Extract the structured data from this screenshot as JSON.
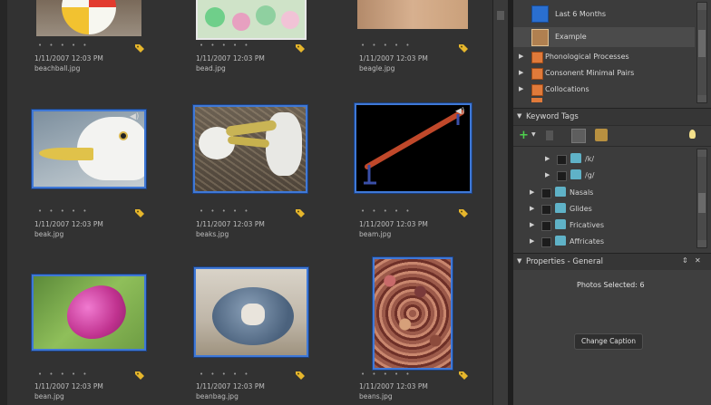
{
  "photos": [
    {
      "date": "1/11/2007 12:03 PM",
      "name": "beachball.jpg"
    },
    {
      "date": "1/11/2007 12:03 PM",
      "name": "bead.jpg"
    },
    {
      "date": "1/11/2007 12:03 PM",
      "name": "beagle.jpg"
    },
    {
      "date": "1/11/2007 12:03 PM",
      "name": "beak.jpg"
    },
    {
      "date": "1/11/2007 12:03 PM",
      "name": "beaks.jpg"
    },
    {
      "date": "1/11/2007 12:03 PM",
      "name": "beam.jpg"
    },
    {
      "date": "1/11/2007 12:03 PM",
      "name": "bean.jpg"
    },
    {
      "date": "1/11/2007 12:03 PM",
      "name": "beanbag.jpg"
    },
    {
      "date": "1/11/2007 12:03 PM",
      "name": "beans.jpg"
    }
  ],
  "stars": "• • • • •",
  "albums": {
    "items": [
      {
        "label": "Last 6 Months"
      },
      {
        "label": "Example"
      },
      {
        "label": "Phonological Processes"
      },
      {
        "label": "Consonent Minimal Pairs"
      },
      {
        "label": "Collocations"
      }
    ]
  },
  "keyword_tags": {
    "title": "Keyword Tags",
    "items": [
      {
        "label": "/k/"
      },
      {
        "label": "/g/"
      },
      {
        "label": "Nasals"
      },
      {
        "label": "Glides"
      },
      {
        "label": "Fricatives"
      },
      {
        "label": "Affricates"
      }
    ]
  },
  "properties": {
    "title": "Properties - General",
    "photos_selected": "Photos Selected: 6",
    "change_caption": "Change Caption"
  },
  "colors": {
    "selection_border": "#3f78d6",
    "album_icon": "#e07a3a",
    "tag_icon": "#5fb2c7"
  }
}
